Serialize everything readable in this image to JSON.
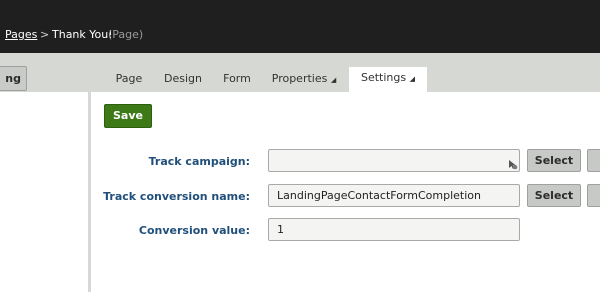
{
  "breadcrumb": {
    "link": "Pages",
    "separator": ">",
    "current": "Thank You!",
    "type": "(Page)"
  },
  "left_panel": {
    "button_label": "ng",
    "tree": {
      "rows": [
        {
          "arrow": false,
          "status": "published"
        },
        {
          "arrow": true,
          "status": "published"
        },
        {
          "arrow": false,
          "status": "published"
        },
        {
          "arrow": false,
          "status": "published"
        },
        {
          "arrow": true,
          "status": "published"
        },
        {
          "arrow": false,
          "status": "published"
        },
        {
          "arrow": true,
          "status": "published"
        }
      ],
      "arrow_glyph": "→"
    }
  },
  "tabs": [
    {
      "label": "Page",
      "active": false
    },
    {
      "label": "Design",
      "active": false
    },
    {
      "label": "Form",
      "active": false
    },
    {
      "label": "Properties",
      "active": false,
      "dropdown": true
    },
    {
      "label": "Settings",
      "active": true,
      "dropdown": true
    }
  ],
  "toolbar": {
    "save_label": "Save"
  },
  "form": {
    "track_campaign": {
      "label": "Track campaign:",
      "value": "",
      "button": "Select"
    },
    "track_conversion_name": {
      "label": "Track conversion name:",
      "value": "LandingPageContactFormCompletion",
      "button": "Select"
    },
    "conversion_value": {
      "label": "Conversion value:",
      "value": "1"
    }
  },
  "colors": {
    "topbar": "#1f1f1f",
    "save_green": "#3d7a17",
    "label_blue": "#1f4f7a",
    "check_green": "#3d8a2c"
  }
}
